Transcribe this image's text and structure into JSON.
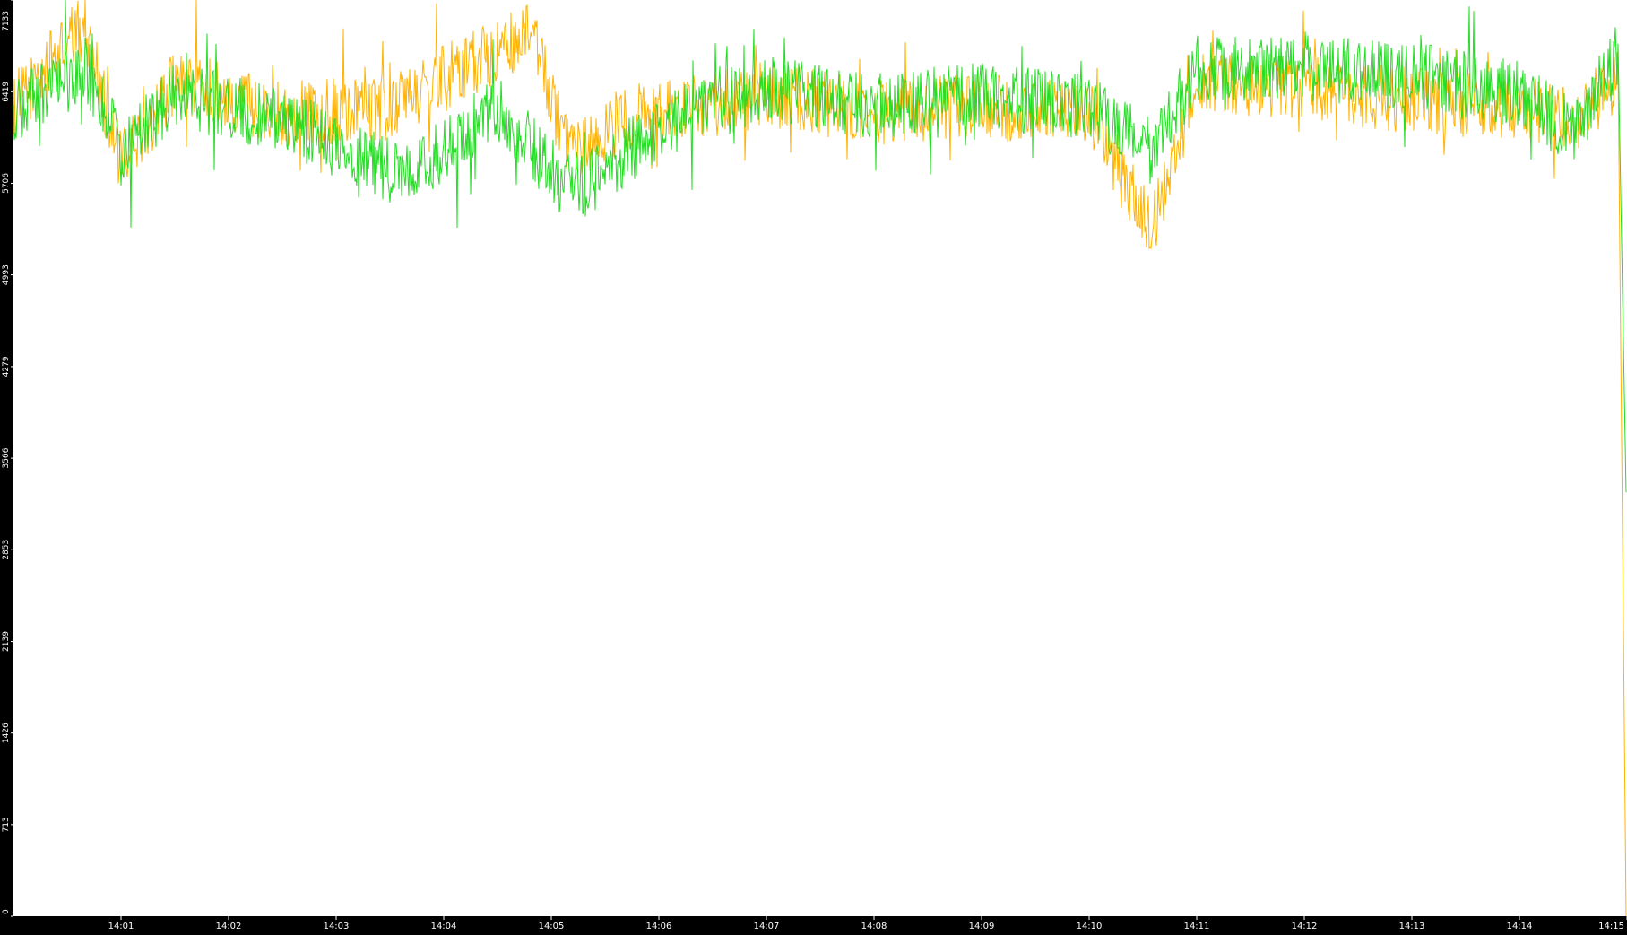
{
  "chart_data": {
    "type": "line",
    "title": "",
    "xlabel": "",
    "ylabel": "",
    "y_ticks": [
      "0",
      "713",
      "1426",
      "2139",
      "2853",
      "3566",
      "4279",
      "4993",
      "5706",
      "6419",
      "7133"
    ],
    "ylim": [
      0,
      7133
    ],
    "x_ticks": [
      "14:01",
      "14:02",
      "14:03",
      "14:04",
      "14:05",
      "14:06",
      "14:07",
      "14:08",
      "14:09",
      "14:10",
      "14:11",
      "14:12",
      "14:13",
      "14:14",
      "14:15"
    ],
    "xlim": [
      "14:00:00",
      "14:15:00"
    ],
    "grid": false,
    "legend": "none",
    "background_color": "#000000",
    "plot_background_color": "#ffffff",
    "series": [
      {
        "color": "#ffb300",
        "x_start": "14:00:00",
        "x_end": "14:15:00",
        "typical_range": [
          5800,
          6900
        ],
        "anchors": [
          [
            "14:00:00",
            6300
          ],
          [
            "14:00:40",
            6950
          ],
          [
            "14:01:00",
            5850
          ],
          [
            "14:01:30",
            6500
          ],
          [
            "14:02:30",
            6250
          ],
          [
            "14:03:30",
            6300
          ],
          [
            "14:04:30",
            6750
          ],
          [
            "14:04:50",
            6850
          ],
          [
            "14:05:10",
            5900
          ],
          [
            "14:05:40",
            6200
          ],
          [
            "14:07:00",
            6400
          ],
          [
            "14:08:00",
            6250
          ],
          [
            "14:09:00",
            6300
          ],
          [
            "14:10:00",
            6250
          ],
          [
            "14:10:35",
            5350
          ],
          [
            "14:11:00",
            6500
          ],
          [
            "14:12:00",
            6450
          ],
          [
            "14:13:00",
            6350
          ],
          [
            "14:14:00",
            6300
          ],
          [
            "14:14:30",
            6200
          ],
          [
            "14:14:55",
            6500
          ],
          [
            "14:15:00",
            0
          ]
        ]
      },
      {
        "color": "#22dd22",
        "x_start": "14:00:00",
        "x_end": "14:15:00",
        "typical_range": [
          5700,
          7000
        ],
        "anchors": [
          [
            "14:00:00",
            6250
          ],
          [
            "14:00:40",
            6600
          ],
          [
            "14:01:00",
            5950
          ],
          [
            "14:01:30",
            6400
          ],
          [
            "14:02:30",
            6200
          ],
          [
            "14:03:40",
            5750
          ],
          [
            "14:04:30",
            6300
          ],
          [
            "14:05:00",
            5800
          ],
          [
            "14:05:20",
            5700
          ],
          [
            "14:06:00",
            6150
          ],
          [
            "14:07:00",
            6450
          ],
          [
            "14:08:00",
            6300
          ],
          [
            "14:09:00",
            6400
          ],
          [
            "14:10:00",
            6300
          ],
          [
            "14:10:35",
            5950
          ],
          [
            "14:11:00",
            6600
          ],
          [
            "14:12:00",
            6600
          ],
          [
            "14:13:00",
            6550
          ],
          [
            "14:14:00",
            6400
          ],
          [
            "14:14:30",
            6100
          ],
          [
            "14:14:55",
            6700
          ],
          [
            "14:15:00",
            3300
          ]
        ]
      }
    ]
  }
}
